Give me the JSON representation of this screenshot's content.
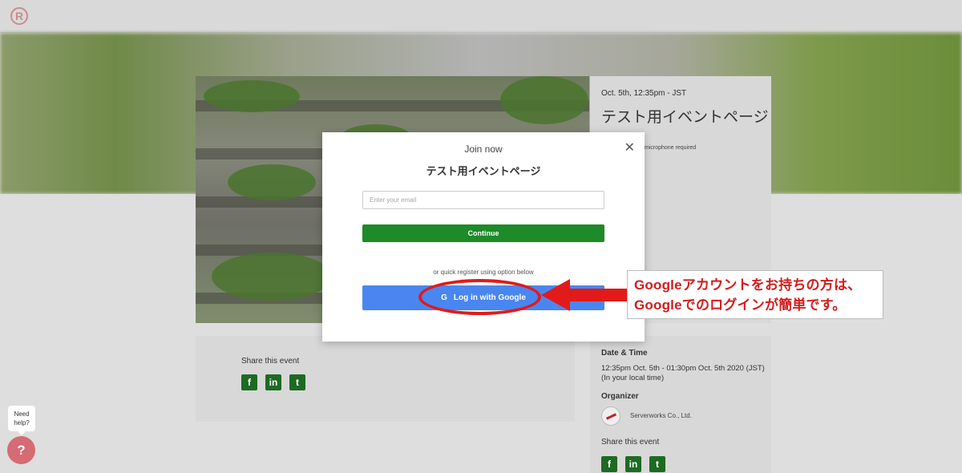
{
  "app": {
    "logo_glyph": "R"
  },
  "event": {
    "date_short": "Oct. 5th, 12:35pm - JST",
    "title": "テスト用イベントページ",
    "mic_note": "microphone required"
  },
  "share": {
    "title": "Share this event",
    "icons": [
      "f",
      "in",
      "t"
    ]
  },
  "details": {
    "date_label": "Date & Time",
    "date_text": "12:35pm Oct. 5th - 01:30pm Oct. 5th 2020 (JST) (In your local time)",
    "organizer_label": "Organizer",
    "organizer_name": "Serverworks Co., Ltd.",
    "share_title": "Share this event"
  },
  "help": {
    "label": "Need help?",
    "icon": "?"
  },
  "modal": {
    "heading": "Join now",
    "event_title": "テスト用イベントページ",
    "email_placeholder": "Enter your email",
    "continue_label": "Continue",
    "quick_text": "or quick register using option below",
    "google_icon": "G",
    "google_label": "Log in with Google",
    "close_glyph": "✕"
  },
  "annotation": {
    "line1": "Googleアカウントをお持ちの方は、",
    "line2": "Googleでのログインが簡単です。",
    "color": "#e31a1a"
  }
}
